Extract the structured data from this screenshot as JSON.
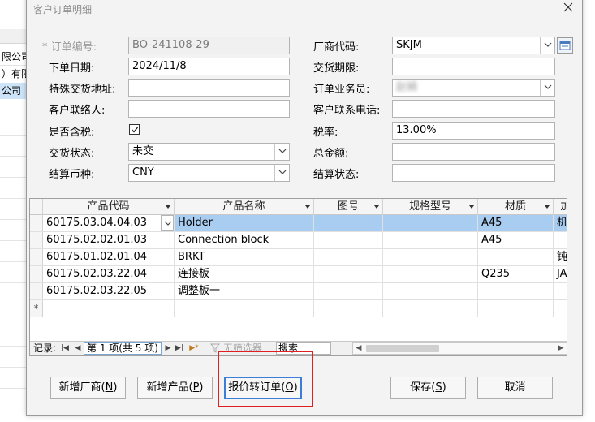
{
  "background_app": {
    "rows": [
      "限公司",
      "）有限",
      "公司"
    ]
  },
  "dialog": {
    "title": "客户订单明细",
    "fields": {
      "order_no": {
        "label": "* 订单编号:",
        "value": "BO-241108-29"
      },
      "order_date": {
        "label": "下单日期:",
        "value": "2024/11/8"
      },
      "special_address": {
        "label": "特殊交货地址:",
        "value": ""
      },
      "customer_contact": {
        "label": "客户联络人:",
        "value": ""
      },
      "tax_included": {
        "label": "是否含税:",
        "checked": true
      },
      "delivery_status": {
        "label": "交货状态:",
        "value": "未交"
      },
      "currency": {
        "label": "结算币种:",
        "value": "CNY"
      },
      "vendor_code": {
        "label": "厂商代码:",
        "value": "SKJM"
      },
      "delivery_deadline": {
        "label": "交货期限:",
        "value": ""
      },
      "salesperson": {
        "label": "订单业务员:",
        "value": "赵娟"
      },
      "customer_phone": {
        "label": "客户联系电话:",
        "value": ""
      },
      "tax_rate": {
        "label": "税率:",
        "value": "13.00%"
      },
      "total_amount": {
        "label": "总金额:",
        "value": ""
      },
      "settlement_status": {
        "label": "结算状态:",
        "value": ""
      }
    },
    "grid": {
      "columns": [
        "产品代码",
        "产品名称",
        "图号",
        "规格型号",
        "材质",
        "加"
      ],
      "rows": [
        {
          "code": "60175.03.04.04.03",
          "name": "Holder",
          "drawing": "",
          "spec": "",
          "material": "A45",
          "extra": "机"
        },
        {
          "code": "60175.02.02.01.03",
          "name": "Connection block",
          "drawing": "",
          "spec": "",
          "material": "A45",
          "extra": ""
        },
        {
          "code": "60175.01.02.01.04",
          "name": "BRKT",
          "drawing": "",
          "spec": "",
          "material": "",
          "extra": "钝"
        },
        {
          "code": "60175.02.03.22.04",
          "name": "连接板",
          "drawing": "",
          "spec": "",
          "material": "Q235",
          "extra": "JA"
        },
        {
          "code": "60175.02.03.22.05",
          "name": "调整板一",
          "drawing": "",
          "spec": "",
          "material": "",
          "extra": ""
        }
      ],
      "new_row_marker": "*",
      "navigator": {
        "label": "记录:",
        "first": "|◀",
        "prev": "◀",
        "page_text": "第 1 项(共 5 项)",
        "next": "▶",
        "last": "▶|",
        "new": "▶*",
        "filter_text": "无筛选器",
        "search_text": "搜索"
      }
    },
    "buttons": {
      "add_vendor": {
        "text": "新增厂商(",
        "key": "N",
        "close": ")"
      },
      "add_product": {
        "text": "新增产品(",
        "key": "P",
        "close": ")"
      },
      "quote_to_order": {
        "text": "报价转订单(",
        "key": "O",
        "close": ")"
      },
      "save": {
        "text": "保存(",
        "key": "S",
        "close": ")"
      },
      "cancel": {
        "text": "取消"
      }
    },
    "colors": {
      "highlight": "#e02020",
      "focus_border": "#3b7dd8",
      "active_row": "#a9cdf0"
    }
  }
}
